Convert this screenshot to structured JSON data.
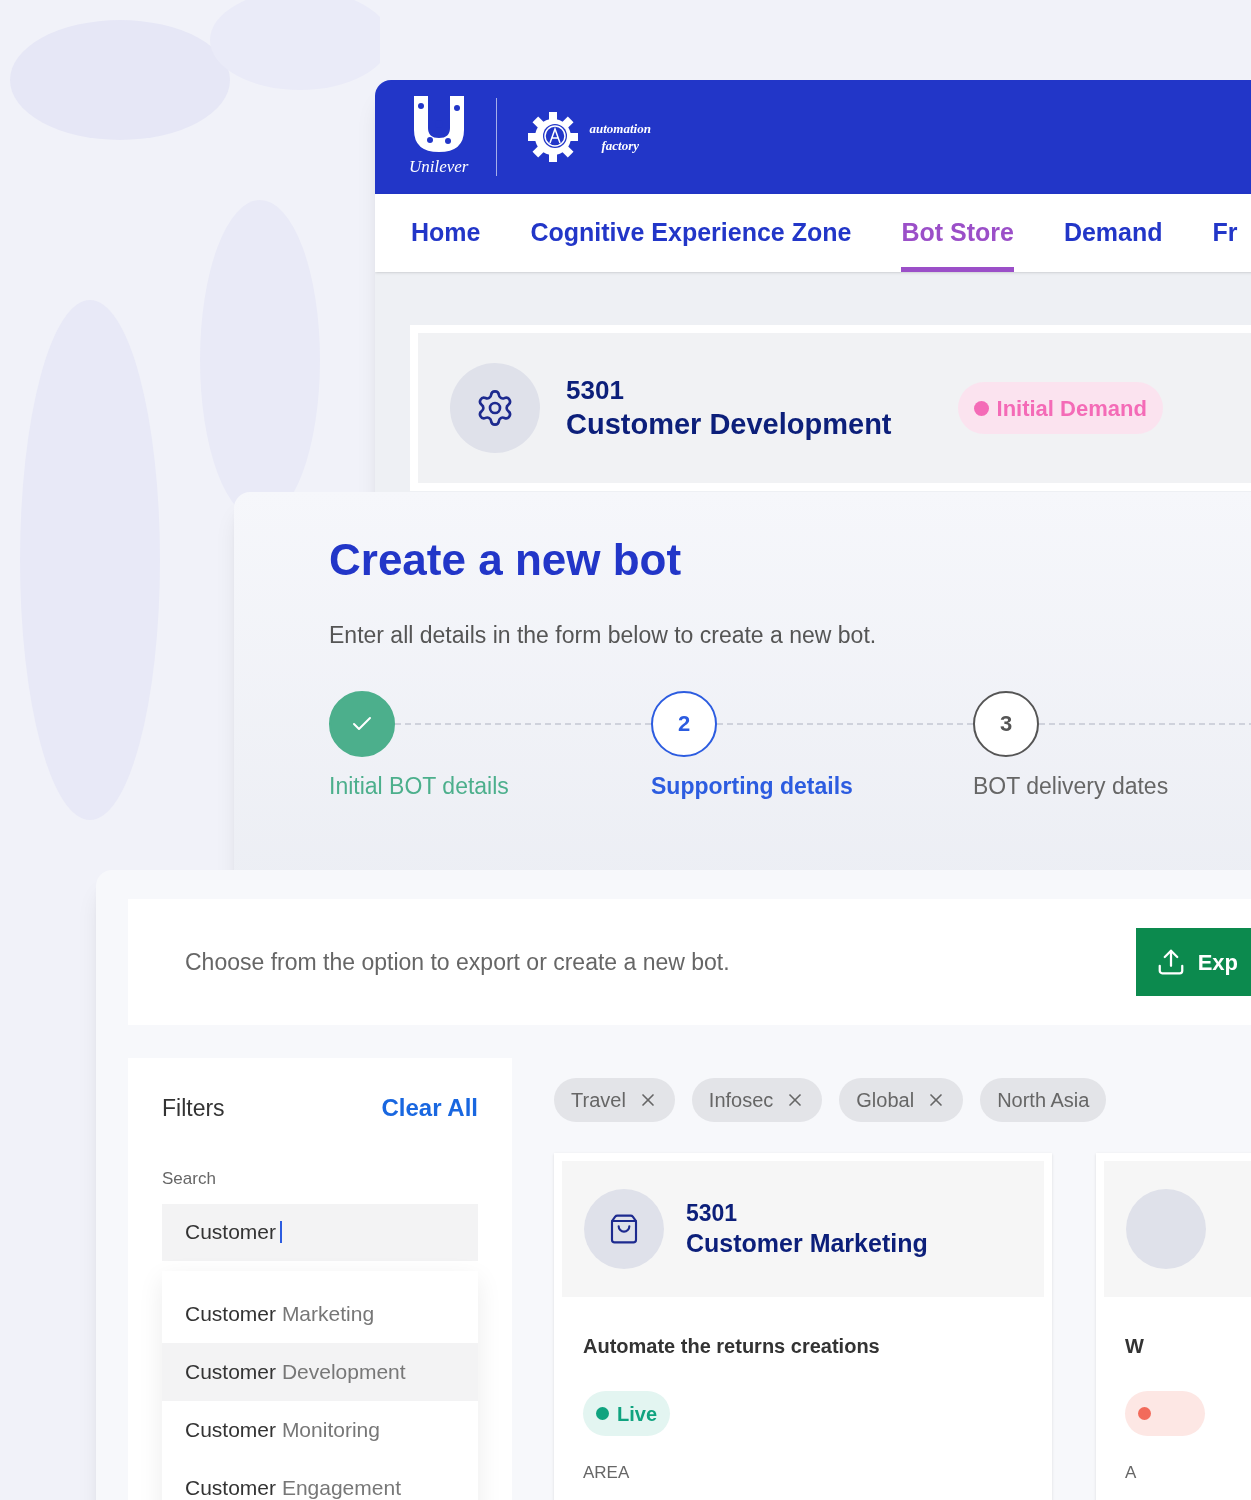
{
  "header": {
    "brand": "Unilever",
    "product_line_1": "automation",
    "product_line_2": "factory"
  },
  "nav": [
    {
      "label": "Home",
      "selected": false
    },
    {
      "label": "Cognitive Experience Zone",
      "selected": false
    },
    {
      "label": "Bot Store",
      "selected": true
    },
    {
      "label": "Demand",
      "selected": false
    },
    {
      "label": "Fr",
      "selected": false
    }
  ],
  "demand_card": {
    "number": "5301",
    "name": "Customer Development",
    "status": "Initial Demand",
    "color": "#f46bb7"
  },
  "create_bot": {
    "title": "Create a new bot",
    "subtitle": "Enter all details in the form below to create a new bot.",
    "steps": [
      {
        "label": "Initial BOT details",
        "kind": "done"
      },
      {
        "number": "2",
        "label": "Supporting details",
        "kind": "current"
      },
      {
        "number": "3",
        "label": "BOT delivery dates",
        "kind": "pending"
      }
    ]
  },
  "export_bar": {
    "text": "Choose from the option to export or create a new bot.",
    "button": "Exp"
  },
  "filters": {
    "title": "Filters",
    "clear": "Clear All",
    "search_label": "Search",
    "search_value": "Customer",
    "suggestions": [
      {
        "match": "Customer",
        "rest": "Marketing",
        "selected": false
      },
      {
        "match": "Customer",
        "rest": "Development",
        "selected": true
      },
      {
        "match": "Customer",
        "rest": "Monitoring",
        "selected": false
      },
      {
        "match": "Customer",
        "rest": "Engagement",
        "selected": false
      }
    ]
  },
  "chips": [
    {
      "label": "Travel",
      "removable": true
    },
    {
      "label": "Infosec",
      "removable": true
    },
    {
      "label": "Global",
      "removable": true
    },
    {
      "label": "North Asia",
      "removable": false
    }
  ],
  "bot_cards": [
    {
      "number": "5301",
      "name": "Customer Marketing",
      "description": "Automate the returns creations",
      "status": "Live",
      "color": "#10a37f",
      "field_label": "AREA"
    },
    {
      "description": "W",
      "field_label": "A",
      "color": "#f26b5b"
    }
  ]
}
